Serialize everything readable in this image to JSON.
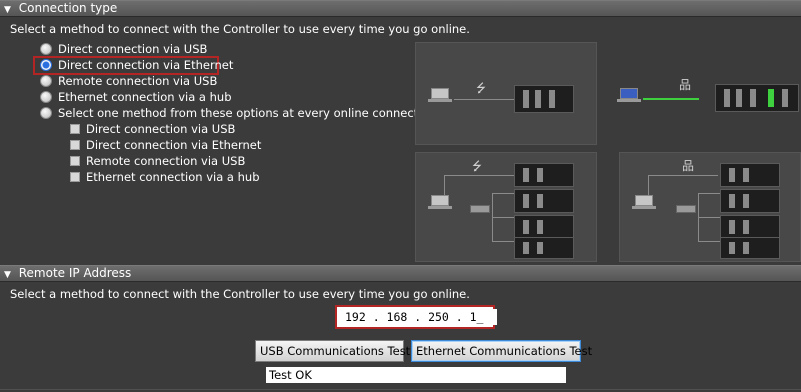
{
  "connection_type": {
    "header": "Connection type",
    "instruction": "Select a method to connect with the Controller to use every time you go online.",
    "options": [
      {
        "label": "Direct connection via USB",
        "selected": false
      },
      {
        "label": "Direct connection via Ethernet",
        "selected": true
      },
      {
        "label": "Remote connection via USB",
        "selected": false
      },
      {
        "label": "Ethernet connection via a hub",
        "selected": false
      },
      {
        "label": "Select one method from these options at every online connection.",
        "selected": false
      }
    ],
    "sub_options": [
      {
        "label": "Direct connection via USB",
        "checked": false
      },
      {
        "label": "Direct connection via Ethernet",
        "checked": false
      },
      {
        "label": "Remote connection via USB",
        "checked": false
      },
      {
        "label": "Ethernet connection via a hub",
        "checked": false
      }
    ]
  },
  "remote_ip": {
    "header": "Remote IP Address",
    "instruction": "Select a method to connect with the Controller to use every time you go online.",
    "ip_value": "192 . 168 . 250 . 1_",
    "usb_test_label": "USB Communications Test",
    "ethernet_test_label": "Ethernet Communications Test",
    "status_text": "Test OK"
  },
  "icons": {
    "usb": "⭍",
    "network": "品",
    "collapse": "▼"
  },
  "colors": {
    "highlight_border": "#b32525",
    "selected_radio": "#2a6fe0",
    "ethernet_link": "#3fd03f"
  }
}
